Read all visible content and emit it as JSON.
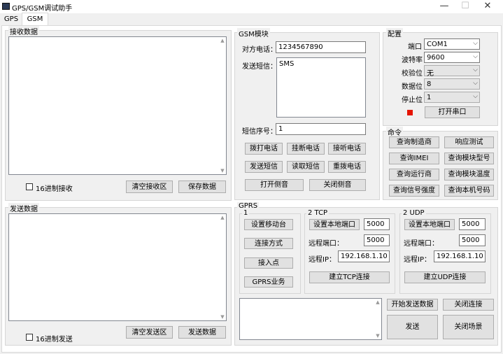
{
  "window": {
    "title": "GPS/GSM调试助手",
    "minimize": "—",
    "maximize": "☐",
    "close": "✕"
  },
  "tabs": [
    {
      "label": "GPS"
    },
    {
      "label": "GSM"
    }
  ],
  "receive": {
    "group": "接收数据",
    "hex_label": "16进制接收",
    "clear_btn": "清空接收区",
    "save_btn": "保存数据"
  },
  "send": {
    "group": "发送数据",
    "hex_label": "16进制发送",
    "clear_btn": "清空发送区",
    "send_btn": "发送数据"
  },
  "gsm": {
    "group": "GSM模块",
    "phone_label": "对方电话：",
    "phone_value": "1234567890",
    "sms_label": "发送短信：",
    "sms_value": "SMS",
    "index_label": "短信序号：",
    "index_value": "1",
    "buttons": [
      "拨打电话",
      "挂断电话",
      "接听电话",
      "发送短信",
      "读取短信",
      "重拨电话",
      "打开侧音",
      "关闭侧音"
    ]
  },
  "config": {
    "group": "配置",
    "port_label": "端口",
    "port_value": "COM1",
    "baud_label": "波特率",
    "baud_value": "9600",
    "parity_label": "校验位",
    "parity_value": "无",
    "databits_label": "数据位",
    "databits_value": "8",
    "stopbits_label": "停止位",
    "stopbits_value": "1",
    "open_btn": "打开串口",
    "indicator_color": "#e51400"
  },
  "commands": {
    "group": "命令",
    "buttons": [
      "查询制造商",
      "响应测试",
      "查询IMEI",
      "查询模块型号",
      "查询运行商",
      "查询模块温度",
      "查询信号强度",
      "查询本机号码"
    ]
  },
  "gprs": {
    "group": "GPRS",
    "step1_title": "1",
    "step1_buttons": [
      "设置移动台",
      "连接方式",
      "接入点",
      "GPRS业务"
    ],
    "tcp": {
      "title": "2 TCP",
      "local_port_btn": "设置本地端口",
      "local_port_value": "5000",
      "remote_port_label": "远程端口：",
      "remote_port_value": "5000",
      "remote_ip_label": "远程IP：",
      "remote_ip_value": "192.168.1.10",
      "connect_btn": "建立TCP连接"
    },
    "udp": {
      "title": "2 UDP",
      "local_port_btn": "设置本地端口",
      "local_port_value": "5000",
      "remote_port_label": "远程端口：",
      "remote_port_value": "5000",
      "remote_ip_label": "远程IP：",
      "remote_ip_value": "192.168.1.10",
      "connect_btn": "建立UDP连接"
    },
    "start_btn": "开始发送数据",
    "close_conn_btn": "关闭连接",
    "send_btn": "发送",
    "close_scene_btn": "关闭场景"
  }
}
